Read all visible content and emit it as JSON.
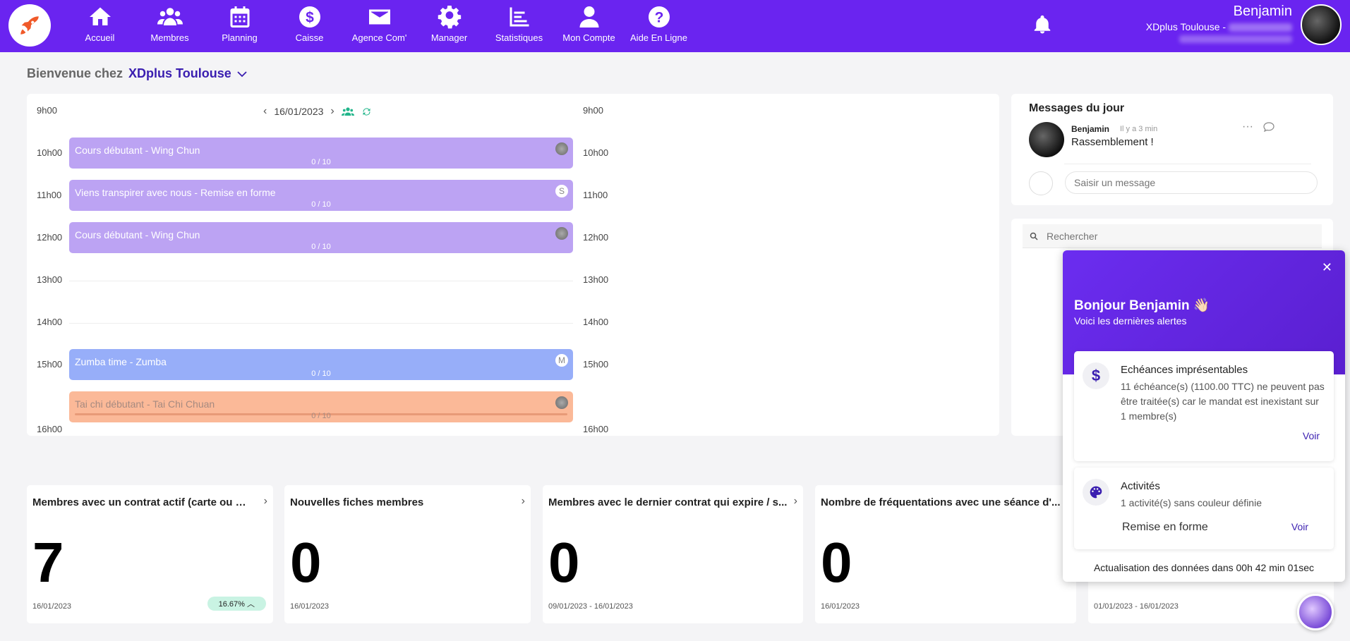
{
  "nav": {
    "items": [
      {
        "label": "Accueil",
        "icon": "home-icon"
      },
      {
        "label": "Membres",
        "icon": "users-icon"
      },
      {
        "label": "Planning",
        "icon": "calendar-icon"
      },
      {
        "label": "Caisse",
        "icon": "dollar-icon"
      },
      {
        "label": "Agence Com'",
        "icon": "mail-icon"
      },
      {
        "label": "Manager",
        "icon": "gear-icon"
      },
      {
        "label": "Statistiques",
        "icon": "chart-icon"
      },
      {
        "label": "Mon Compte",
        "icon": "user-icon"
      },
      {
        "label": "Aide En Ligne",
        "icon": "help-icon"
      }
    ]
  },
  "user": {
    "name": "Benjamin",
    "club": "XDplus Toulouse -"
  },
  "welcome": {
    "prefix": "Bienvenue chez",
    "club": "XDplus Toulouse"
  },
  "planning": {
    "date": "16/01/2023",
    "hours": [
      "9h00",
      "10h00",
      "11h00",
      "12h00",
      "13h00",
      "14h00",
      "15h00",
      "16h00"
    ],
    "events": [
      {
        "title": "Cours débutant - Wing Chun",
        "count": "0 / 10",
        "badge": ""
      },
      {
        "title": "Viens transpirer avec nous - Remise en forme",
        "count": "0 / 10",
        "badge": "S"
      },
      {
        "title": "Cours débutant - Wing Chun",
        "count": "0 / 10",
        "badge": ""
      },
      {
        "title": "Zumba time - Zumba",
        "count": "0 / 10",
        "badge": "M"
      },
      {
        "title": "Tai chi débutant - Tai Chi Chuan",
        "count": "0 / 10",
        "badge": ""
      }
    ]
  },
  "messages": {
    "title": "Messages du jour",
    "author": "Benjamin",
    "time": "Il y a 3 min",
    "text": "Rassemblement !",
    "input_placeholder": "Saisir un message"
  },
  "search": {
    "placeholder": "Rechercher"
  },
  "stats": [
    {
      "title": "Membres avec un contrat actif (carte ou abo)",
      "value": "7",
      "date": "16/01/2023",
      "badge": "16.67%"
    },
    {
      "title": "Nouvelles fiches membres",
      "value": "0",
      "date": "16/01/2023"
    },
    {
      "title": "Membres avec le dernier contrat qui expire / s...",
      "value": "0",
      "date": "09/01/2023 - 16/01/2023"
    },
    {
      "title": "Nombre de fréquentations avec une séance d'...",
      "value": "0",
      "date": "16/01/2023"
    },
    {
      "title": "",
      "value": "",
      "date": "01/01/2023 - 16/01/2023"
    }
  ],
  "alerts": {
    "title": "Bonjour Benjamin 👋🏻",
    "subtitle": "Voici les dernières alertes",
    "items": [
      {
        "title": "Echéances imprésentables",
        "text": "11 échéance(s) (1100.00 TTC) ne peuvent pas être traitée(s) car le mandat est inexistant sur 1 membre(s)",
        "action": "Voir",
        "icon": "dollar-icon"
      },
      {
        "title": "Activités",
        "text": "1 activité(s) sans couleur définie",
        "extra": "Remise en forme",
        "action": "Voir",
        "icon": "palette-icon"
      }
    ],
    "footer": "Actualisation des données dans 00h 42 min 01sec"
  },
  "colors": {
    "brand": "#6a24f0",
    "accent": "#3a1eb0",
    "event_purple": "#bca3f3",
    "event_blue": "#97aef9",
    "event_orange": "#fbb998"
  }
}
